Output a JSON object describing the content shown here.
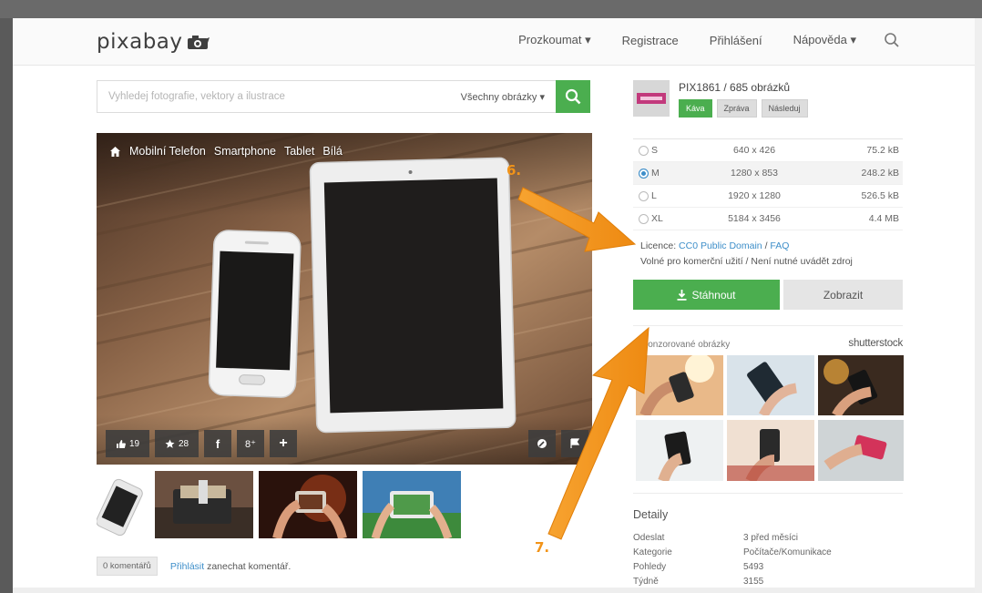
{
  "header": {
    "logo_text": "pixabay",
    "nav": [
      {
        "label": "Prozkoumat ▾"
      },
      {
        "label": "Registrace"
      },
      {
        "label": "Přihlášení"
      },
      {
        "label": "Nápověda ▾"
      }
    ]
  },
  "search": {
    "placeholder": "Vyhledej fotografie, vektory a ilustrace",
    "filter_label": "Všechny obrázky ▾"
  },
  "photo": {
    "tags": [
      "Mobilní Telefon",
      "Smartphone",
      "Tablet",
      "Bílá"
    ],
    "like_count": "19",
    "fav_count": "28",
    "facebook_label": "f",
    "gplus_label": "8⁺",
    "plus_label": "+"
  },
  "comments": {
    "count_label": "0 komentářů",
    "login_link": "Přihlásit",
    "rest_text": "zanechat komentář."
  },
  "author": {
    "name": "PIX1861 / 685 obrázků",
    "btn_coffee": "Káva",
    "btn_follow": "Zprávа",
    "btn_next": "Následuj"
  },
  "sizes": [
    {
      "label": "S",
      "dims": "640 x 426",
      "file": "75.2 kB",
      "selected": false
    },
    {
      "label": "M",
      "dims": "1280 x 853",
      "file": "248.2 kB",
      "selected": true
    },
    {
      "label": "L",
      "dims": "1920 x 1280",
      "file": "526.5 kB",
      "selected": false
    },
    {
      "label": "XL",
      "dims": "5184 x 3456",
      "file": "4.4 MB",
      "selected": false
    }
  ],
  "license": {
    "prefix": "Licence:",
    "cc0": "CC0 Public Domain",
    "sep": "/",
    "faq": "FAQ",
    "note": "Volné pro komerční užití / Není nutné uvádět zdroj"
  },
  "buttons": {
    "download": "Stáhnout",
    "view": "Zobrazit"
  },
  "sponsored": {
    "label": "Sponzorované obrázky",
    "brand": "shutterstock"
  },
  "details": {
    "title": "Detaily",
    "rows": [
      {
        "k": "Odeslat",
        "v": "3 před měsíci",
        "link": false
      },
      {
        "k": "Kategorie",
        "v": "Počítače/Komunikace",
        "link": true
      },
      {
        "k": "Pohledy",
        "v": "5493",
        "link": false
      },
      {
        "k": "Týdně",
        "v": "3155",
        "link": false
      }
    ]
  },
  "annotations": {
    "step6": "6.",
    "step7": "7."
  },
  "colors": {
    "accent_green": "#4bae4f",
    "link_blue": "#3d8ec9",
    "annotation_orange": "#f29419"
  }
}
